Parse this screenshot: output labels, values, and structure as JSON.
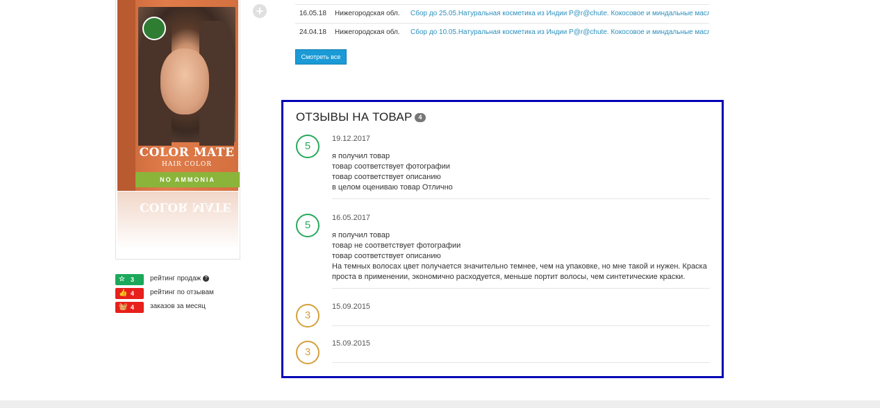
{
  "colors": {
    "accent_blue": "#1a9ad6",
    "link": "#2a8fbd",
    "highlight_border": "#0000b5",
    "score_good": "#27a85a",
    "score_mid": "#d4a03a",
    "badge_green": "#1ba85a",
    "badge_red": "#e8201c"
  },
  "product": {
    "brand": "COLOR MATE",
    "brand_sub": "HAIR COLOR",
    "tag": "NO AMMONIA",
    "zoom_icon": "zoom-in-icon"
  },
  "badges": [
    {
      "icon": "star-icon",
      "value": "3",
      "label": "рейтинг продаж",
      "color": "#1ba85a"
    },
    {
      "icon": "thumbs-up-icon",
      "value": "4",
      "label": "рейтинг по отзывам",
      "color": "#e8201c"
    },
    {
      "icon": "basket-icon",
      "value": "4",
      "label": "заказов за месяц",
      "color": "#e8201c"
    }
  ],
  "orders": [
    {
      "date": "16.05.18",
      "region": "Нижегородская обл.",
      "link": "Сбор до 25.05.Натуральная косметика из Индии P@r@chute. Кокосовое и миндальные масла"
    },
    {
      "date": "24.04.18",
      "region": "Нижегородская обл.",
      "link": "Сбор до 10.05.Натуральная косметика из Индии P@r@chute. Кокосовое и миндальные масла"
    }
  ],
  "see_all_label": "Смотреть все",
  "reviews": {
    "title": "ОТЗЫВЫ НА ТОВАР",
    "count": "4",
    "items": [
      {
        "score": "5",
        "date": "19.12.2017",
        "lines": [
          "я получил товар",
          "товар соответствует фотографии",
          "товар соответствует описанию",
          "в целом оцениваю товар Отлично"
        ]
      },
      {
        "score": "5",
        "date": "16.05.2017",
        "lines": [
          "я получил товар",
          "товар не соответствует фотографии",
          "товар соответствует описанию",
          "На темных волосах цвет получается значительно темнее, чем на упаковке, но мне такой и нужен. Краска",
          "проста в применении, экономично расходуется, меньше портит волосы, чем синтетические краски."
        ]
      },
      {
        "score": "3",
        "date": "15.09.2015",
        "lines": []
      },
      {
        "score": "3",
        "date": "15.09.2015",
        "lines": []
      }
    ]
  }
}
